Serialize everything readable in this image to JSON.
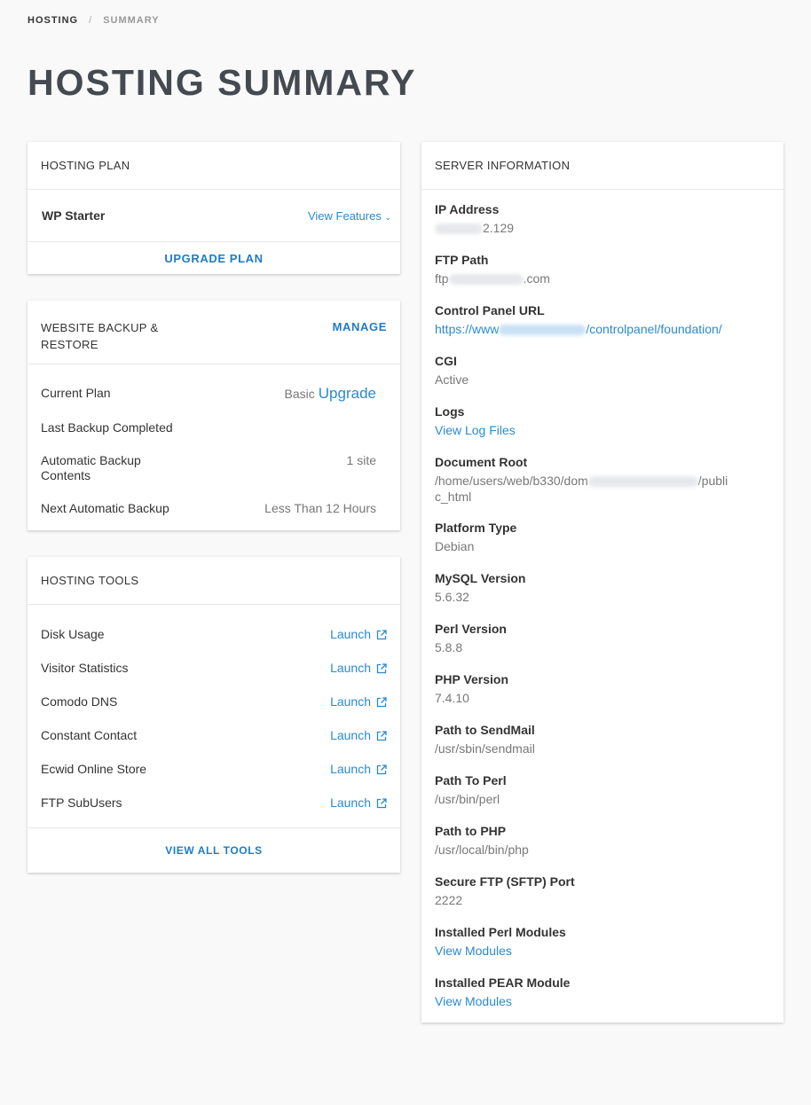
{
  "breadcrumb": {
    "home": "HOSTING",
    "separator": "/",
    "current": "SUMMARY"
  },
  "page_title": "HOSTING SUMMARY",
  "hosting_plan": {
    "header": "HOSTING PLAN",
    "plan_name": "WP Starter",
    "view_features": "View Features",
    "upgrade": "UPGRADE PLAN"
  },
  "backup": {
    "header": "WEBSITE BACKUP & RESTORE",
    "manage": "MANAGE",
    "current_plan_label": "Current Plan",
    "current_plan_value": "Basic",
    "upgrade_link": "Upgrade",
    "last_backup_label": "Last Backup Completed",
    "contents_label": "Automatic Backup Contents",
    "contents_value": "1 site",
    "next_label": "Next Automatic Backup",
    "next_value": "Less Than 12 Hours"
  },
  "tools": {
    "header": "HOSTING TOOLS",
    "launch": "Launch",
    "items": [
      "Disk Usage",
      "Visitor Statistics",
      "Comodo DNS",
      "Constant Contact",
      "Ecwid Online Store",
      "FTP SubUsers"
    ],
    "view_all": "VIEW ALL TOOLS"
  },
  "server": {
    "header": "SERVER INFORMATION",
    "ip_label": "IP Address",
    "ip_suffix": "2.129",
    "ftp_label": "FTP Path",
    "ftp_prefix": "ftp",
    "ftp_suffix": ".com",
    "cp_label": "Control Panel URL",
    "cp_prefix": "https://www",
    "cp_suffix": "/controlpanel/foundation/",
    "cgi_label": "CGI",
    "cgi_value": "Active",
    "logs_label": "Logs",
    "logs_link": "View Log Files",
    "docroot_label": "Document Root",
    "docroot_prefix": "/home/users/web/b330/dom",
    "docroot_suffix": "/publi",
    "docroot_line2": "c_html",
    "platform_label": "Platform Type",
    "platform_value": "Debian",
    "mysql_label": "MySQL Version",
    "mysql_value": "5.6.32",
    "perl_label": "Perl Version",
    "perl_value": "5.8.8",
    "php_label": "PHP Version",
    "php_value": "7.4.10",
    "sendmail_label": "Path to SendMail",
    "sendmail_value": "/usr/sbin/sendmail",
    "perlpath_label": "Path To Perl",
    "perlpath_value": "/usr/bin/perl",
    "phppath_label": "Path to PHP",
    "phppath_value": "/usr/local/bin/php",
    "sftp_label": "Secure FTP (SFTP) Port",
    "sftp_value": "2222",
    "perlmods_label": "Installed Perl Modules",
    "perlmods_link": "View Modules",
    "pear_label": "Installed PEAR Module",
    "pear_link": "View Modules"
  }
}
